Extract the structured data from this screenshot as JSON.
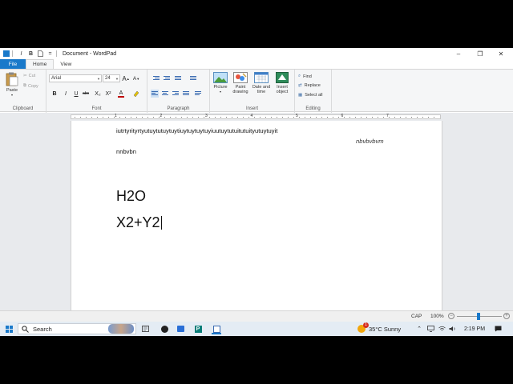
{
  "window": {
    "title": "Document - WordPad",
    "min_symbol": "–",
    "max_symbol": "❐",
    "close_symbol": "✕"
  },
  "quick_access": {
    "italic": "I",
    "bold": "B",
    "more": "="
  },
  "menu": {
    "file": "File",
    "home": "Home",
    "view": "View"
  },
  "clipboard": {
    "paste": "Paste",
    "cut": "Cut",
    "copy": "Copy",
    "group": "Clipboard"
  },
  "font": {
    "family": "Arial",
    "size": "24",
    "group": "Font",
    "bold": "B",
    "italic": "I",
    "underline": "U",
    "strike": "abc",
    "subscript": "X₂",
    "superscript": "X²",
    "color_letter": "A"
  },
  "paragraph": {
    "group": "Paragraph"
  },
  "insert": {
    "group": "Insert",
    "picture": "Picture",
    "paint": "Paint drawing",
    "datetime": "Date and time",
    "object": "Insert object"
  },
  "editing": {
    "group": "Editing",
    "find": "Find",
    "replace": "Replace",
    "select_all": "Select all"
  },
  "ruler": {
    "marks": [
      "1",
      "2",
      "3",
      "4",
      "5",
      "6",
      "7"
    ]
  },
  "document": {
    "line1": "iutrtyrityrtyutuytutuytuytiuytuytuytuyiuutuytutuitutuityutuytuyit",
    "line2": "nbvbvbvm",
    "line3": "nnbvbn",
    "line4": "H2O",
    "line5": "X2+Y2"
  },
  "status": {
    "caps": "CAP",
    "zoom": "100%"
  },
  "taskbar": {
    "search": "Search",
    "weather": "35°C  Sunny",
    "time": "2:19 PM",
    "weather_badge": "1"
  },
  "colors": {
    "accent": "#1979ca",
    "ribbon": "#f5f6f7",
    "doc_bg": "#e8eaed"
  }
}
